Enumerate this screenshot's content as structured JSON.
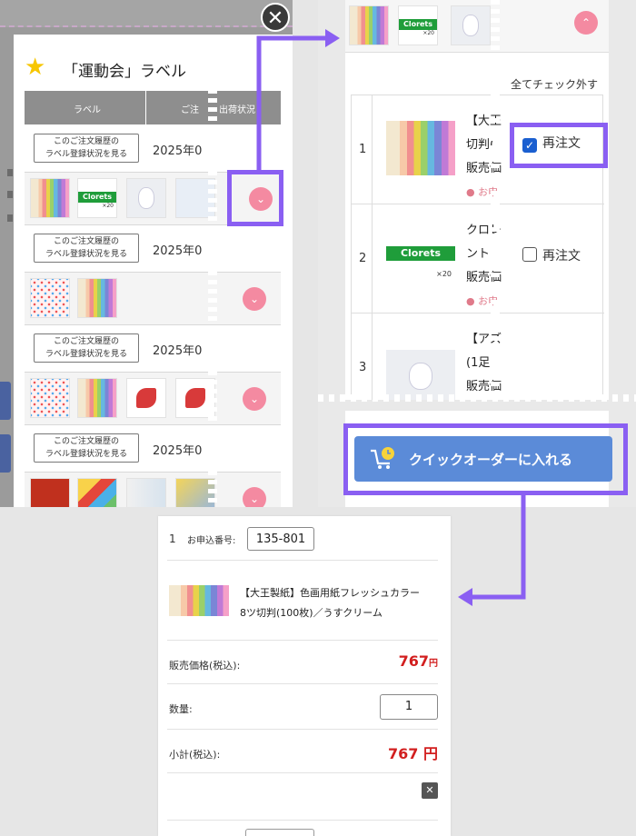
{
  "colors": {
    "accent": "#8a5ff2",
    "pink_button": "#f48aa1",
    "quick_button": "#5b8bd8",
    "price_red": "#d21f1f"
  },
  "panel1": {
    "title": "「運動会」ラベル",
    "close_icon": "✕",
    "star_icon": "★",
    "header": {
      "label_col": "ラベル",
      "order_col": "ご注",
      "ship_col": "出荷状況"
    },
    "history_button": [
      "このご注文履歴の",
      "ラベル登録状況を見る"
    ],
    "date_prefix": "2025年0",
    "clorets_text": "Clorets",
    "x20": "×20",
    "chevron": "⌄"
  },
  "panel2": {
    "uncheck_all": "全てチェック外す",
    "rows": [
      {
        "no": "1",
        "line1": "【大王",
        "line2": "切判(",
        "line3": "販売価",
        "line4": "● お申",
        "check_label": "再注文",
        "checked": true
      },
      {
        "no": "2",
        "line1": "クロレ",
        "line2": "ント",
        "line3": "販売価",
        "line4": "● お申",
        "check_label": "再注文",
        "checked": false
      },
      {
        "no": "3",
        "line1": "【アズ",
        "line2": "(1足",
        "line3": "販売価",
        "line4": "",
        "check_label": "",
        "checked": false
      }
    ],
    "quick_order_button": "クイックオーダーに入れる",
    "chevron_up": "⌃",
    "clorets_text": "Clorets",
    "x20": "×20"
  },
  "panel3": {
    "row_no": "1",
    "application_label": "お申込番号:",
    "application_value": "135-801",
    "product_name_1": "【大王製紙】色画用紙フレッシュカラー",
    "product_name_2": "8ツ切判(100枚)／うすクリーム",
    "price_label": "販売価格(税込):",
    "price_value": "767",
    "price_unit": "円",
    "qty_label": "数量:",
    "qty_value": "1",
    "subtotal_label": "小計(税込):",
    "subtotal_value": "767 円",
    "delete_icon": "✕"
  }
}
